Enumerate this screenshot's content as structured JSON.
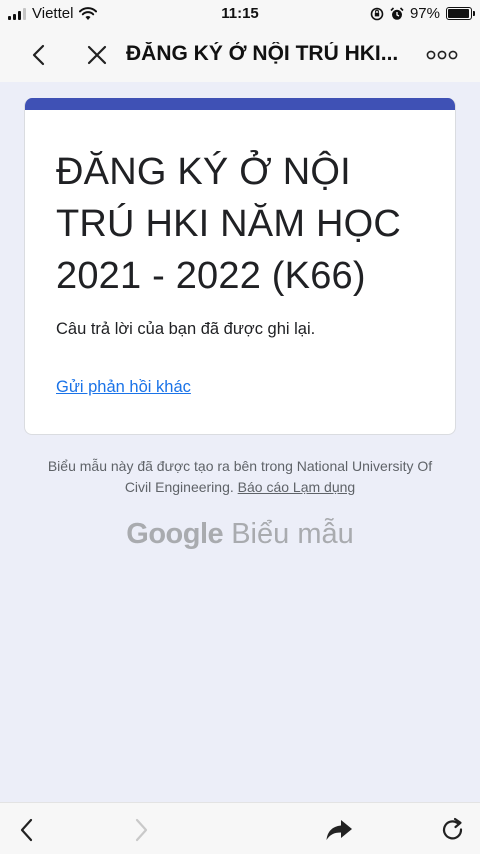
{
  "status_bar": {
    "carrier": "Viettel",
    "time": "11:15",
    "battery_percent": "97%",
    "battery_level": 0.97,
    "icons": [
      "signal-icon",
      "wifi-icon",
      "orientation-lock-icon",
      "alarm-icon",
      "battery-icon"
    ]
  },
  "nav": {
    "title": "ĐĂNG KÝ Ở NỘI TRÚ HKI...",
    "icons": [
      "back-icon",
      "close-icon",
      "more-icon"
    ]
  },
  "card": {
    "accent_color": "#3f51b5",
    "title": "ĐĂNG KÝ Ở NỘI TRÚ HKI NĂM HỌC 2021 - 2022 (K66)",
    "confirmation": "Câu trả lời của bạn đã được ghi lại.",
    "resubmit_link": "Gửi phản hồi khác"
  },
  "footer": {
    "note": "Biểu mẫu này đã được tạo ra bên trong National University Of Civil Engineering.",
    "abuse_link": "Báo cáo Lạm dụng",
    "brand_google": "Google",
    "brand_product": "Biểu mẫu"
  },
  "bottom_bar": {
    "icons": [
      "browser-back-icon",
      "browser-forward-icon",
      "share-icon",
      "reload-icon"
    ]
  }
}
